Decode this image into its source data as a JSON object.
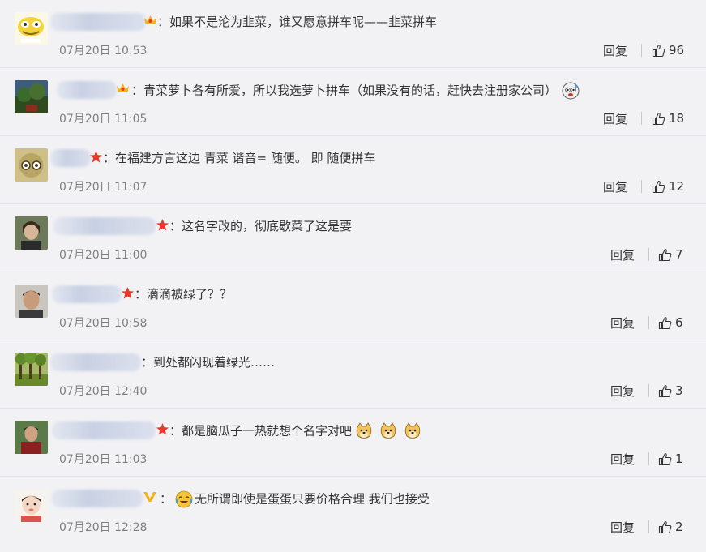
{
  "comments": [
    {
      "badge": "crown",
      "text": "：如果不是沦为韭菜，谁又愿意拼车呢——韭菜拼车",
      "time": "07月20日 10:53",
      "reply_label": "回复",
      "likes": "96",
      "trailing_emojis": []
    },
    {
      "badge": "crown",
      "text": "：青菜萝卜各有所爱，所以我选萝卜拼车（如果没有的话，赶快去注册家公司）",
      "time": "07月20日 11:05",
      "reply_label": "回复",
      "likes": "18",
      "trailing_emojis": [
        "doge-sweat"
      ]
    },
    {
      "badge": "star",
      "text": "：在福建方言这边 青菜 谐音= 随便。 即 随便拼车",
      "time": "07月20日 11:07",
      "reply_label": "回复",
      "likes": "12",
      "trailing_emojis": []
    },
    {
      "badge": "star",
      "text": "：这名字改的，彻底歇菜了这是要",
      "time": "07月20日 11:00",
      "reply_label": "回复",
      "likes": "7",
      "trailing_emojis": []
    },
    {
      "badge": "star",
      "text": "：滴滴被绿了？？",
      "time": "07月20日 10:58",
      "reply_label": "回复",
      "likes": "6",
      "trailing_emojis": []
    },
    {
      "badge": "none",
      "text": "：到处都闪现着绿光……",
      "time": "07月20日 12:40",
      "reply_label": "回复",
      "likes": "3",
      "trailing_emojis": []
    },
    {
      "badge": "star",
      "text": "：都是脑瓜子一热就想个名字对吧",
      "time": "07月20日 11:03",
      "reply_label": "回复",
      "likes": "1",
      "trailing_emojis": [
        "doge",
        "doge",
        "doge"
      ]
    },
    {
      "badge": "verified-v",
      "text": "无所谓即使是蛋蛋只要价格合理 我们也接受",
      "time": "07月20日 12:28",
      "reply_label": "回复",
      "likes": "2",
      "trailing_emojis": []
    }
  ],
  "colors": {
    "background": "#f2f2f5",
    "time_text": "#808080",
    "crown": "#f6b21a",
    "star": "#e8382d",
    "verified": "#f6b21a"
  }
}
